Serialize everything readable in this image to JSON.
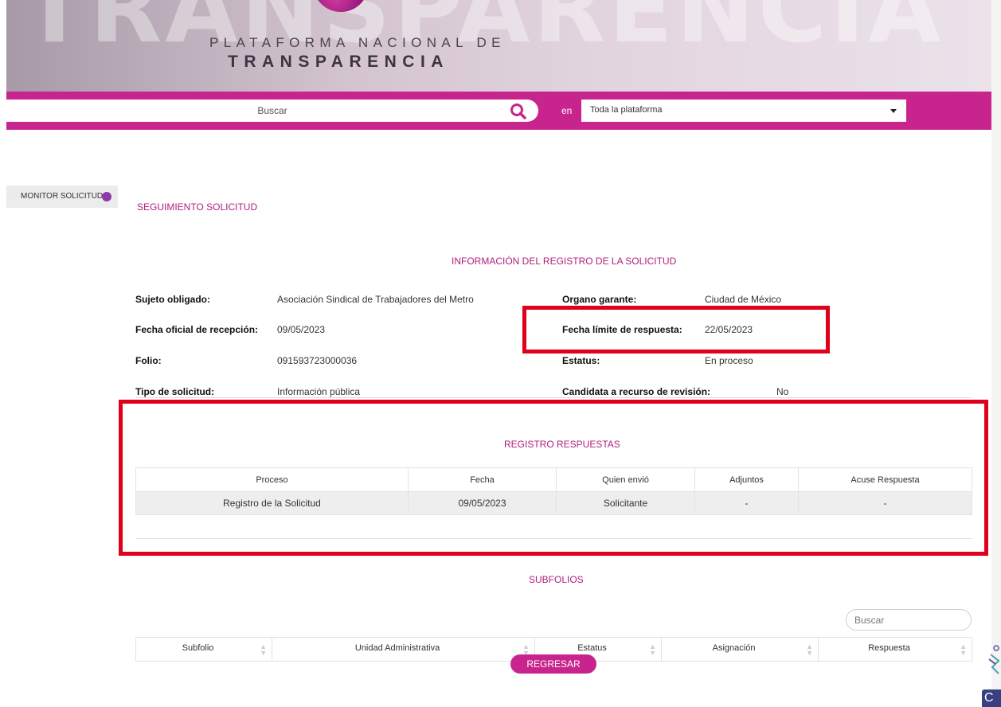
{
  "header": {
    "watermark": "TRANSPARENCIA",
    "brand_line1": "PLATAFORMA NACIONAL DE",
    "brand_line2": "TRANSPARENCIA"
  },
  "search": {
    "placeholder": "Buscar",
    "in_label": "en",
    "scope_value": "Toda la plataforma"
  },
  "sidebar": {
    "tab_label": "MONITOR SOLICITUD"
  },
  "page": {
    "title": "SEGUIMIENTO SOLICITUD"
  },
  "info": {
    "section_title": "INFORMACIÓN DEL REGISTRO DE LA SOLICITUD",
    "sujeto_label": "Sujeto obligado:",
    "sujeto_value": "Asociación Sindical de Trabajadores del Metro",
    "organo_label": "Organo garante:",
    "organo_value": "Ciudad de México",
    "fecha_recepcion_label": "Fecha oficial de recepción:",
    "fecha_recepcion_value": "09/05/2023",
    "fecha_limite_label": "Fecha límite de respuesta:",
    "fecha_limite_value": "22/05/2023",
    "folio_label": "Folio:",
    "folio_value": "091593723000036",
    "estatus_label": "Estatus:",
    "estatus_value": "En proceso",
    "tipo_label": "Tipo de solicitud:",
    "tipo_value": "Información pública",
    "candidata_label": "Candidata a recurso de revisión:",
    "candidata_value": "No"
  },
  "respuestas": {
    "title": "REGISTRO RESPUESTAS",
    "headers": [
      "Proceso",
      "Fecha",
      "Quien envió",
      "Adjuntos",
      "Acuse Respuesta"
    ],
    "rows": [
      [
        "Registro de la Solicitud",
        "09/05/2023",
        "Solicitante",
        "-",
        "-"
      ]
    ]
  },
  "subfolios": {
    "title": "SUBFOLIOS",
    "search_placeholder": "Buscar",
    "headers": [
      "Subfolio",
      "Unidad Administrativa",
      "Estatus",
      "Asignación",
      "Respuesta"
    ]
  },
  "actions": {
    "back_label": "REGRESAR"
  },
  "colors": {
    "accent": "#c8248e",
    "title": "#b0207e",
    "highlight": "#e0001b"
  }
}
